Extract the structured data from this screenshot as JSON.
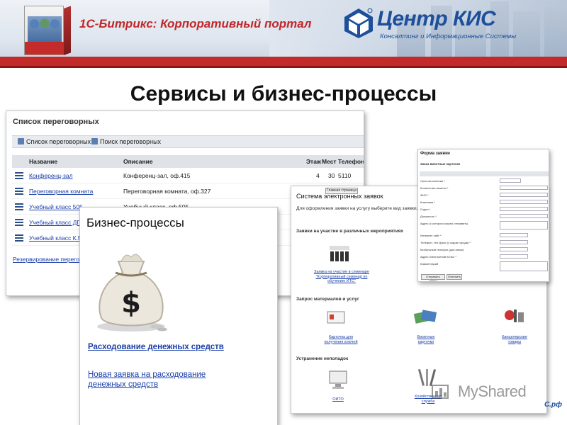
{
  "header": {
    "product_title": "1С-Битрикс: Корпоративный портал",
    "company_name": "Центр КИС",
    "company_tagline": "Консалтинг и Информационные Системы",
    "box_label": "1С-Битрикс: Корпоративный портал",
    "brand_color": "#c0282a",
    "accent_color": "#1d4f9a"
  },
  "slide": {
    "title": "Сервисы и бизнес-процессы"
  },
  "rooms_panel": {
    "title": "Список переговорных",
    "toolbar": [
      "Список переговорных",
      "Поиск переговорных"
    ],
    "columns": [
      "Название",
      "Описание",
      "Этаж",
      "Мест",
      "Телефон"
    ],
    "rows": [
      {
        "name": "Конференц-зал",
        "desc": "Конференц-зал, оф.415",
        "floor": "4",
        "seats": "30",
        "phone": "5110"
      },
      {
        "name": "Переговорная комната",
        "desc": "Переговорная комната, оф.327",
        "floor": "",
        "seats": "",
        "phone": ""
      },
      {
        "name": "Учебный класс 505",
        "desc": "Учебный класс, оф.505",
        "floor": "",
        "seats": "",
        "phone": ""
      },
      {
        "name": "Учебный класс ДП",
        "desc": "",
        "floor": "",
        "seats": "",
        "phone": ""
      },
      {
        "name": "Учебный класс К.М",
        "desc": "",
        "floor": "",
        "seats": "",
        "phone": ""
      }
    ],
    "footer_link": "Резервирование переговорных"
  },
  "bp_panel": {
    "title": "Бизнес-процессы",
    "link_main": "Расходование денежных средств",
    "link_new": "Новая заявка на расходование денежных средств"
  },
  "ereq_panel": {
    "title": "Система электронных заявок",
    "tooltip": "Главная страница",
    "intro": "Для оформления заявки на услугу выберите вид заявки, а зат",
    "sections": [
      "Заявки на участие в различных мероприятиях",
      "Запрос материалов и услуг",
      "Устранение неполадок"
    ],
    "items": {
      "seminar": "Заявка на участие в семинаре \"Корпоративный семинар по обучению ИТС\"",
      "card": "Карточка для получения ключей",
      "business_cards": "Визитные карточки",
      "stationery": "Канцелярские товары",
      "it": "ОИТО",
      "household": "Хозяйственная служба"
    }
  },
  "form_panel": {
    "title": "Форма заявки",
    "subtitle": "Заказ визитных карточек",
    "fields": [
      "Срок исполнения *",
      "Количество визиток *",
      "ФИО *",
      "Компания *",
      "Отдел *",
      "Должность *",
      "Адрес (с которого можно отправить)",
      "Интернет сайт *",
      "Телефон, тел./факс (с кодом города) *",
      "Мобильный телефон (для связи)",
      "Адрес электронной почты *",
      "Комментарий"
    ],
    "buttons": [
      "Отправить заявку",
      "Отменить"
    ]
  },
  "watermark": {
    "text": "MyShared",
    "suffix": "С.рф"
  }
}
